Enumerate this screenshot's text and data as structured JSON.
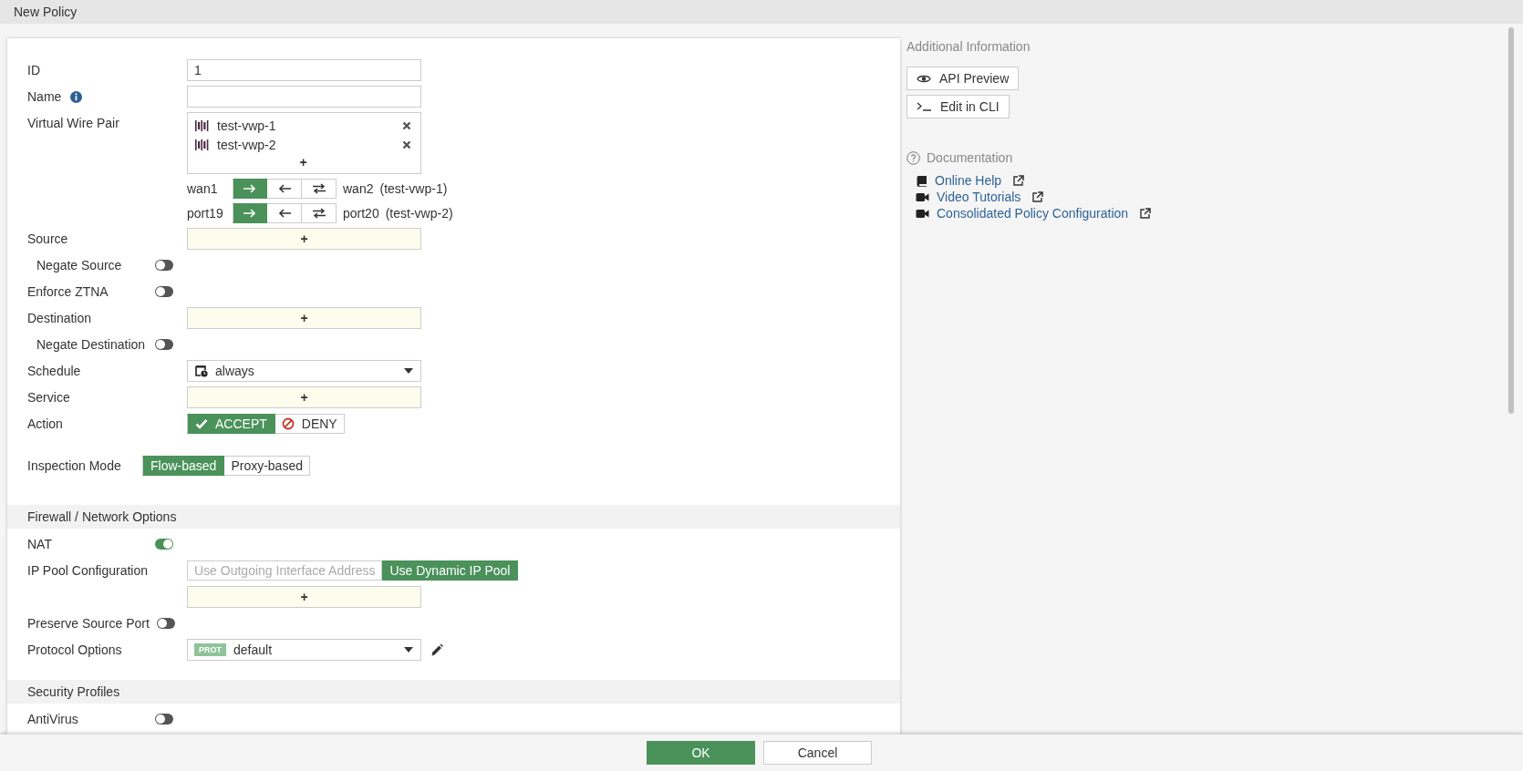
{
  "window": {
    "title": "New Policy"
  },
  "form": {
    "sections": [
      {
        "rows": [
          {
            "kind": "input",
            "label": "ID",
            "value": "1"
          },
          {
            "kind": "input",
            "label": "Name",
            "info": true
          },
          {
            "kind": "list",
            "label": "Virtual Wire Pair",
            "items": [
              "test-vwp-1",
              "test-vwp-2"
            ],
            "add": "+"
          },
          {
            "kind": "direction",
            "from": "wan1",
            "to": "wan2",
            "pair": "(test-vwp-1)",
            "directions": [
              {
                "kind": "forward",
                "selected": true
              },
              {
                "kind": "backward",
                "selected": false
              },
              {
                "kind": "both",
                "selected": false
              }
            ]
          },
          {
            "kind": "direction",
            "from": "port19",
            "to": "port20",
            "pair": "(test-vwp-2)",
            "directions": [
              {
                "kind": "forward",
                "selected": true
              },
              {
                "kind": "backward",
                "selected": false
              },
              {
                "kind": "both",
                "selected": false
              }
            ]
          },
          {
            "kind": "add",
            "label": "Source",
            "add": "+",
            "children": [
              {
                "kind": "toggle",
                "label": "Negate Source",
                "on": false
              }
            ]
          },
          {
            "kind": "toggle",
            "label": "Enforce ZTNA",
            "on": false
          },
          {
            "kind": "add",
            "label": "Destination",
            "add": "+",
            "children": [
              {
                "kind": "toggle",
                "label": "Negate Destination",
                "on": false
              }
            ]
          },
          {
            "kind": "select",
            "label": "Schedule",
            "value": "always"
          },
          {
            "kind": "add",
            "label": "Service",
            "add": "+"
          },
          {
            "kind": "segmented",
            "label": "Action",
            "options": [
              {
                "kind": "accept",
                "label": "ACCEPT",
                "selected": true
              },
              {
                "kind": "deny",
                "label": "DENY",
                "selected": false
              }
            ]
          },
          {
            "kind": "mode",
            "label": "Inspection Mode",
            "options": [
              {
                "label": "Flow-based",
                "selected": true
              },
              {
                "label": "Proxy-based",
                "selected": false
              }
            ]
          }
        ]
      },
      {
        "title": "Firewall / Network Options",
        "rows": [
          {
            "kind": "toggle",
            "label": "NAT",
            "on": true
          },
          {
            "kind": "segmented",
            "label": "IP Pool Configuration",
            "options": [
              {
                "label": "Use Outgoing Interface Address",
                "selected": false,
                "disabled": true
              },
              {
                "label": "Use Dynamic IP Pool",
                "selected": true,
                "disabled": false
              }
            ]
          },
          {
            "kind": "add",
            "add": "+"
          },
          {
            "kind": "toggle",
            "label": "Preserve Source Port",
            "on": false
          },
          {
            "kind": "select",
            "label": "Protocol Options",
            "badge": "PROT",
            "value": "default"
          }
        ]
      },
      {
        "title": "Security Profiles",
        "rows": [
          {
            "kind": "toggle",
            "label": "AntiVirus",
            "on": false
          }
        ]
      }
    ]
  },
  "side_panel": {
    "heading": "Additional Information",
    "buttons": [
      {
        "kind": "preview",
        "label": "API Preview"
      },
      {
        "kind": "cli",
        "label": "Edit in CLI"
      }
    ],
    "documentation": {
      "title": "Documentation",
      "links": [
        {
          "kind": "book",
          "label": "Online Help"
        },
        {
          "kind": "video",
          "label": "Video Tutorials"
        },
        {
          "kind": "video",
          "label": "Consolidated Policy Configuration"
        }
      ]
    }
  },
  "footer": {
    "buttons": [
      {
        "kind": "primary",
        "label": "OK"
      },
      {
        "kind": "secondary",
        "label": "Cancel"
      }
    ]
  }
}
